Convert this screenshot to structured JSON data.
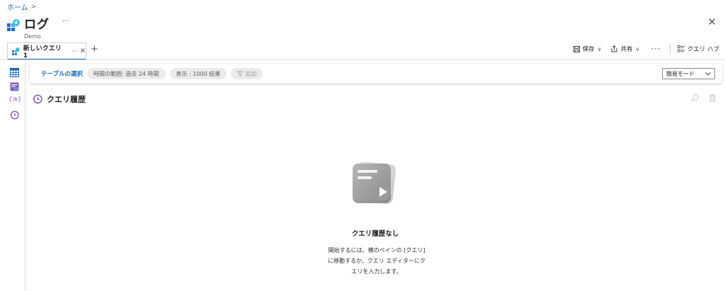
{
  "breadcrumb": {
    "home": "ホーム",
    "separator": ">"
  },
  "header": {
    "title": "ログ",
    "more": "···",
    "subtitle": "Demo",
    "close": "✕"
  },
  "tabs": [
    {
      "label": "新しいクエリ 1",
      "more": "···",
      "close": "✕"
    }
  ],
  "add_tab": "+",
  "toolbar": {
    "save": "保存",
    "share": "共有",
    "more": "···",
    "query_hub": "クエリ ハブ",
    "caret": "∨"
  },
  "left_rail": {
    "icons": [
      "tables-icon",
      "queries-icon",
      "functions-icon",
      "history-icon"
    ],
    "functions_glyph": "{𝑓x}"
  },
  "query_bar": {
    "table_select": "テーブルの選択",
    "time_range": "時間の範囲:  過去 24 時間",
    "show": "表示 : 1000 結果",
    "add_filter": "追加",
    "mode": "簡易モード"
  },
  "history": {
    "title": "クエリ履歴",
    "empty_title": "クエリ履歴なし",
    "empty_desc_line1": "開始するには、横のペインの [クエリ]",
    "empty_desc_line2": "に移動するか、クエリ エディターにク",
    "empty_desc_line3": "エリを入力します。"
  },
  "colors": {
    "accent": "#0f6cbd",
    "history_purple": "#8a5cb4",
    "border": "#e1dfdd"
  }
}
